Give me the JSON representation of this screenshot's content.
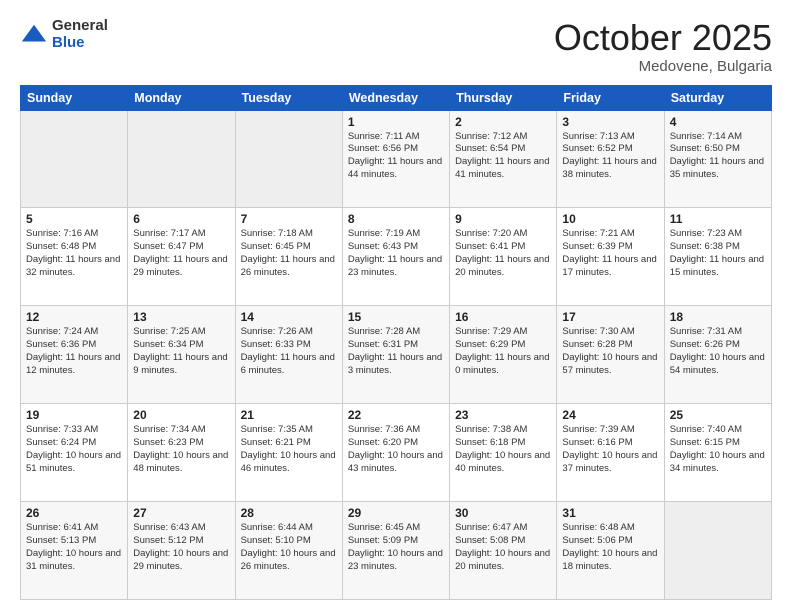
{
  "header": {
    "logo_general": "General",
    "logo_blue": "Blue",
    "title": "October 2025",
    "location": "Medovene, Bulgaria"
  },
  "columns": [
    "Sunday",
    "Monday",
    "Tuesday",
    "Wednesday",
    "Thursday",
    "Friday",
    "Saturday"
  ],
  "weeks": [
    [
      {
        "day": "",
        "info": ""
      },
      {
        "day": "",
        "info": ""
      },
      {
        "day": "",
        "info": ""
      },
      {
        "day": "1",
        "info": "Sunrise: 7:11 AM\nSunset: 6:56 PM\nDaylight: 11 hours and 44 minutes."
      },
      {
        "day": "2",
        "info": "Sunrise: 7:12 AM\nSunset: 6:54 PM\nDaylight: 11 hours and 41 minutes."
      },
      {
        "day": "3",
        "info": "Sunrise: 7:13 AM\nSunset: 6:52 PM\nDaylight: 11 hours and 38 minutes."
      },
      {
        "day": "4",
        "info": "Sunrise: 7:14 AM\nSunset: 6:50 PM\nDaylight: 11 hours and 35 minutes."
      }
    ],
    [
      {
        "day": "5",
        "info": "Sunrise: 7:16 AM\nSunset: 6:48 PM\nDaylight: 11 hours and 32 minutes."
      },
      {
        "day": "6",
        "info": "Sunrise: 7:17 AM\nSunset: 6:47 PM\nDaylight: 11 hours and 29 minutes."
      },
      {
        "day": "7",
        "info": "Sunrise: 7:18 AM\nSunset: 6:45 PM\nDaylight: 11 hours and 26 minutes."
      },
      {
        "day": "8",
        "info": "Sunrise: 7:19 AM\nSunset: 6:43 PM\nDaylight: 11 hours and 23 minutes."
      },
      {
        "day": "9",
        "info": "Sunrise: 7:20 AM\nSunset: 6:41 PM\nDaylight: 11 hours and 20 minutes."
      },
      {
        "day": "10",
        "info": "Sunrise: 7:21 AM\nSunset: 6:39 PM\nDaylight: 11 hours and 17 minutes."
      },
      {
        "day": "11",
        "info": "Sunrise: 7:23 AM\nSunset: 6:38 PM\nDaylight: 11 hours and 15 minutes."
      }
    ],
    [
      {
        "day": "12",
        "info": "Sunrise: 7:24 AM\nSunset: 6:36 PM\nDaylight: 11 hours and 12 minutes."
      },
      {
        "day": "13",
        "info": "Sunrise: 7:25 AM\nSunset: 6:34 PM\nDaylight: 11 hours and 9 minutes."
      },
      {
        "day": "14",
        "info": "Sunrise: 7:26 AM\nSunset: 6:33 PM\nDaylight: 11 hours and 6 minutes."
      },
      {
        "day": "15",
        "info": "Sunrise: 7:28 AM\nSunset: 6:31 PM\nDaylight: 11 hours and 3 minutes."
      },
      {
        "day": "16",
        "info": "Sunrise: 7:29 AM\nSunset: 6:29 PM\nDaylight: 11 hours and 0 minutes."
      },
      {
        "day": "17",
        "info": "Sunrise: 7:30 AM\nSunset: 6:28 PM\nDaylight: 10 hours and 57 minutes."
      },
      {
        "day": "18",
        "info": "Sunrise: 7:31 AM\nSunset: 6:26 PM\nDaylight: 10 hours and 54 minutes."
      }
    ],
    [
      {
        "day": "19",
        "info": "Sunrise: 7:33 AM\nSunset: 6:24 PM\nDaylight: 10 hours and 51 minutes."
      },
      {
        "day": "20",
        "info": "Sunrise: 7:34 AM\nSunset: 6:23 PM\nDaylight: 10 hours and 48 minutes."
      },
      {
        "day": "21",
        "info": "Sunrise: 7:35 AM\nSunset: 6:21 PM\nDaylight: 10 hours and 46 minutes."
      },
      {
        "day": "22",
        "info": "Sunrise: 7:36 AM\nSunset: 6:20 PM\nDaylight: 10 hours and 43 minutes."
      },
      {
        "day": "23",
        "info": "Sunrise: 7:38 AM\nSunset: 6:18 PM\nDaylight: 10 hours and 40 minutes."
      },
      {
        "day": "24",
        "info": "Sunrise: 7:39 AM\nSunset: 6:16 PM\nDaylight: 10 hours and 37 minutes."
      },
      {
        "day": "25",
        "info": "Sunrise: 7:40 AM\nSunset: 6:15 PM\nDaylight: 10 hours and 34 minutes."
      }
    ],
    [
      {
        "day": "26",
        "info": "Sunrise: 6:41 AM\nSunset: 5:13 PM\nDaylight: 10 hours and 31 minutes."
      },
      {
        "day": "27",
        "info": "Sunrise: 6:43 AM\nSunset: 5:12 PM\nDaylight: 10 hours and 29 minutes."
      },
      {
        "day": "28",
        "info": "Sunrise: 6:44 AM\nSunset: 5:10 PM\nDaylight: 10 hours and 26 minutes."
      },
      {
        "day": "29",
        "info": "Sunrise: 6:45 AM\nSunset: 5:09 PM\nDaylight: 10 hours and 23 minutes."
      },
      {
        "day": "30",
        "info": "Sunrise: 6:47 AM\nSunset: 5:08 PM\nDaylight: 10 hours and 20 minutes."
      },
      {
        "day": "31",
        "info": "Sunrise: 6:48 AM\nSunset: 5:06 PM\nDaylight: 10 hours and 18 minutes."
      },
      {
        "day": "",
        "info": ""
      }
    ]
  ],
  "accent_color": "#1a5bbf"
}
